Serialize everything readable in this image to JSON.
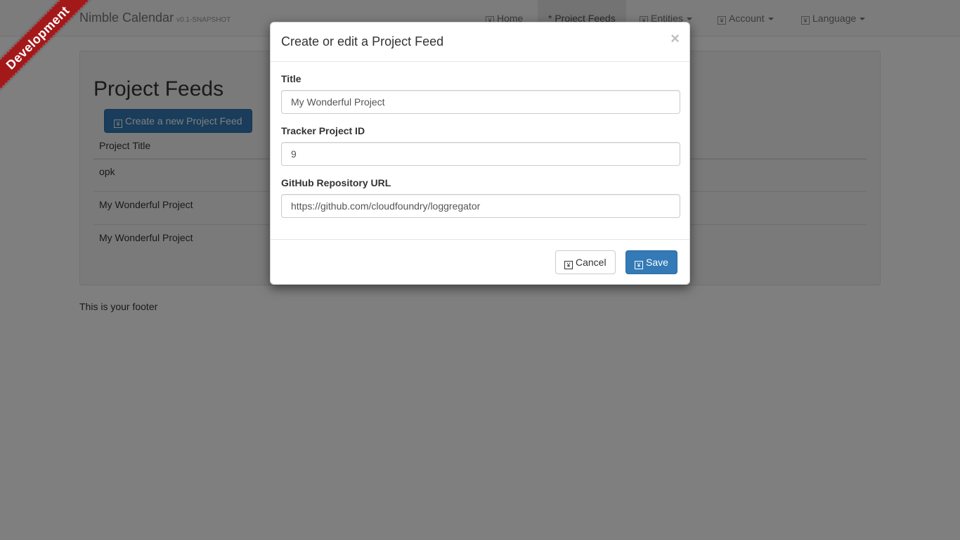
{
  "navbar": {
    "brand": "Nimble Calendar",
    "version": "v0.1-SNAPSHOT",
    "items": [
      {
        "label": "Home",
        "icon": "home-icon"
      },
      {
        "label": "* Project Feeds",
        "icon": ""
      },
      {
        "label": "Entities",
        "icon": "entities-icon"
      },
      {
        "label": "Account",
        "icon": "account-icon"
      },
      {
        "label": "Language",
        "icon": "language-icon"
      }
    ]
  },
  "ribbon": {
    "label": "Development",
    "color": "#a3191a"
  },
  "page": {
    "title": "Project Feeds",
    "create_button": "Create a new Project Feed",
    "table": {
      "headers": [
        "Project Title"
      ],
      "rows": [
        "opk",
        "My Wonderful Project",
        "My Wonderful Project"
      ]
    },
    "footer": "This is your footer"
  },
  "modal": {
    "title": "Create or edit a Project Feed",
    "close": "×",
    "fields": {
      "title": {
        "label": "Title",
        "value": "My Wonderful Project"
      },
      "tracker": {
        "label": "Tracker Project ID",
        "value": "9"
      },
      "github": {
        "label": "GitHub Repository URL",
        "value": "https://github.com/cloudfoundry/loggregator"
      }
    },
    "cancel_label": "Cancel",
    "save_label": "Save"
  },
  "colors": {
    "primary": "#337ab7",
    "ribbon": "#a3191a",
    "backdrop": "rgba(0,0,0,0.5)"
  }
}
